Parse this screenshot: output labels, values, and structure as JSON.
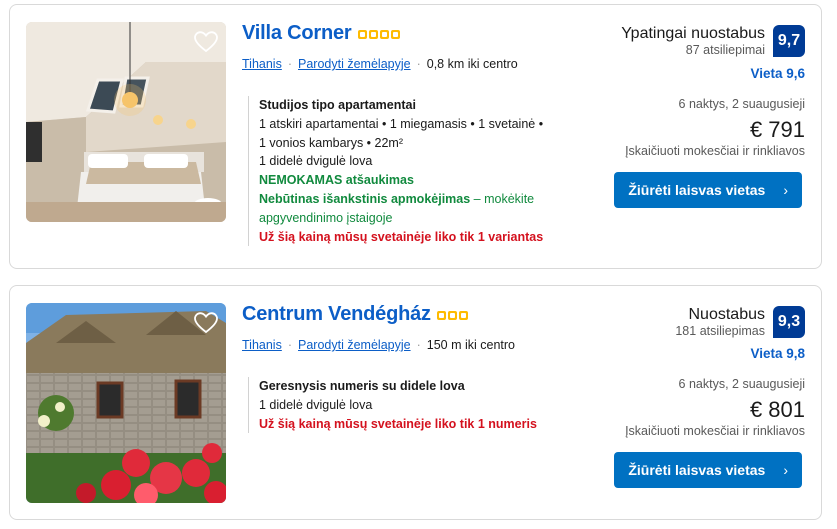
{
  "results": [
    {
      "title": "Villa Corner",
      "stars": 4,
      "town": "Tihanis",
      "map_link": "Parodyti žemėlapyje",
      "distance": "0,8 km iki centro",
      "room_name": "Studijos tipo apartamentai",
      "room_lines": [
        "1 atskiri apartamentai • 1 miegamasis • 1 svetainė •",
        "1 vonios kambarys • 22m²",
        "1 didelė dvigulė lova"
      ],
      "free_cancel": "NEMOKAMAS atšaukimas",
      "no_prepay": "Nebūtinas išankstinis apmokėjimas",
      "no_prepay_rest": " – mokėkite apgyvendinimo įstaigoje",
      "scarcity": "Už šią kainą mūsų svetainėje liko tik 1 variantas",
      "score_label": "Ypatingai nuostabus",
      "reviews": "87 atsiliepimai",
      "score": "9,7",
      "location_score": "Vieta 9,6",
      "nights": "6 naktys, 2 suaugusieji",
      "price": "€ 791",
      "taxes": "Įskaičiuoti mokesčiai ir rinkliavos",
      "button": "Žiūrėti laisvas vietas"
    },
    {
      "title": "Centrum Vendégház",
      "stars": 3,
      "town": "Tihanis",
      "map_link": "Parodyti žemėlapyje",
      "distance": "150 m iki centro",
      "room_name": "Geresnysis numeris su didele lova",
      "room_lines": [
        "1 didelė dvigulė lova"
      ],
      "scarcity": "Už šią kainą mūsų svetainėje liko tik 1 numeris",
      "score_label": "Nuostabus",
      "reviews": "181 atsiliepimas",
      "score": "9,3",
      "location_score": "Vieta 9,8",
      "nights": "6 naktys, 2 suaugusieji",
      "price": "€ 801",
      "taxes": "Įskaičiuoti mokesčiai ir rinkliavos",
      "button": "Žiūrėti laisvas vietas"
    }
  ],
  "icons": {
    "wishlist": "heart-outline-icon",
    "button_arrow": "chevron-right-icon",
    "stars": "star-icon"
  },
  "colors": {
    "link_blue": "#0c5ec7",
    "score_badge": "#003b95",
    "button_blue": "#0071c2",
    "green": "#118a3e",
    "red": "#d4111e",
    "star_yellow": "#febb02"
  }
}
